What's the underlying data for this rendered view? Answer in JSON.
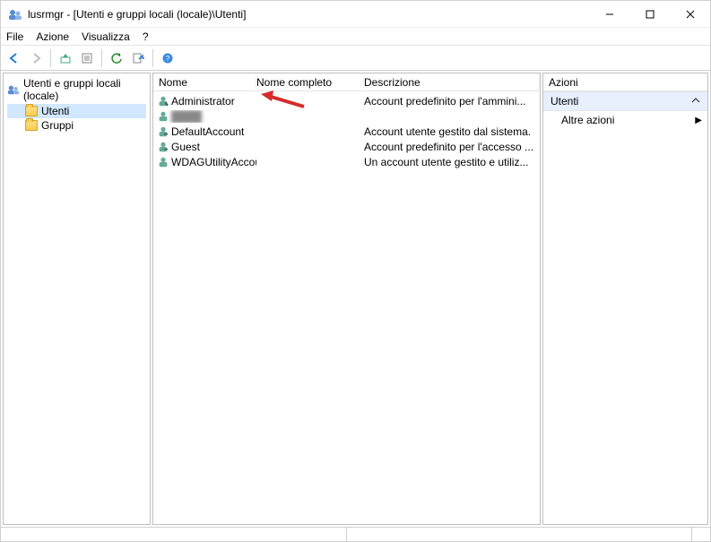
{
  "window": {
    "title": "lusrmgr - [Utenti e gruppi locali (locale)\\Utenti]"
  },
  "menu": {
    "file": "File",
    "action": "Azione",
    "view": "Visualizza",
    "help": "?"
  },
  "tree": {
    "root": "Utenti e gruppi locali (locale)",
    "users": "Utenti",
    "groups": "Gruppi"
  },
  "columns": {
    "name": "Nome",
    "fullname": "Nome completo",
    "description": "Descrizione"
  },
  "users": [
    {
      "name": "Administrator",
      "fullname": "",
      "description": "Account predefinito per l'ammini..."
    },
    {
      "name": "",
      "fullname": "",
      "description": ""
    },
    {
      "name": "DefaultAccount",
      "fullname": "",
      "description": "Account utente gestito dal sistema."
    },
    {
      "name": "Guest",
      "fullname": "",
      "description": "Account predefinito per l'accesso ..."
    },
    {
      "name": "WDAGUtilityAccount",
      "fullname": "",
      "description": "Un account utente gestito e utiliz..."
    }
  ],
  "actions": {
    "header": "Azioni",
    "group": "Utenti",
    "more": "Altre azioni"
  }
}
